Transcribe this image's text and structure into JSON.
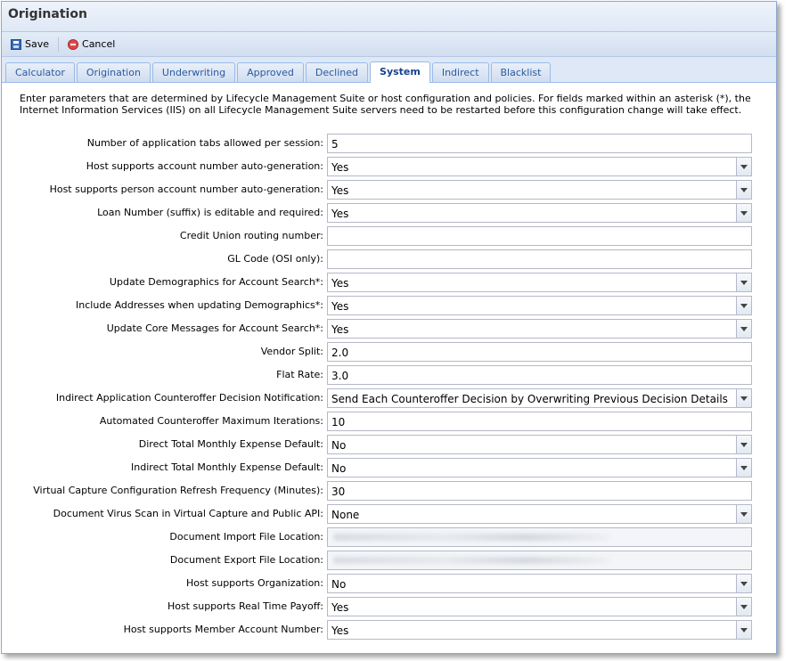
{
  "window": {
    "title": "Origination"
  },
  "toolbar": {
    "save_label": "Save",
    "cancel_label": "Cancel"
  },
  "tabs": [
    {
      "label": "Calculator"
    },
    {
      "label": "Origination"
    },
    {
      "label": "Underwriting"
    },
    {
      "label": "Approved"
    },
    {
      "label": "Declined"
    },
    {
      "label": "System",
      "active": true
    },
    {
      "label": "Indirect"
    },
    {
      "label": "Blacklist"
    }
  ],
  "intro": "Enter parameters that are determined by Lifecycle Management Suite or host configuration and policies. For fields marked within an asterisk (*), the Internet Information Services (IIS) on all Lifecycle Management Suite servers need to be restarted before this configuration change will take effect.",
  "fields": [
    {
      "label": "Number of application tabs allowed per session:",
      "value": "5",
      "type": "text"
    },
    {
      "label": "Host supports account number auto-generation:",
      "value": "Yes",
      "type": "combo"
    },
    {
      "label": "Host supports person account number auto-generation:",
      "value": "Yes",
      "type": "combo"
    },
    {
      "label": "Loan Number (suffix) is editable and required:",
      "value": "Yes",
      "type": "combo"
    },
    {
      "label": "Credit Union routing number:",
      "value": "",
      "type": "text"
    },
    {
      "label": "GL Code (OSI only):",
      "value": "",
      "type": "text"
    },
    {
      "label": "Update Demographics for Account Search*:",
      "value": "Yes",
      "type": "combo"
    },
    {
      "label": "Include Addresses when updating Demographics*:",
      "value": "Yes",
      "type": "combo"
    },
    {
      "label": "Update Core Messages for Account Search*:",
      "value": "Yes",
      "type": "combo"
    },
    {
      "label": "Vendor Split:",
      "value": "2.0",
      "type": "text"
    },
    {
      "label": "Flat Rate:",
      "value": "3.0",
      "type": "text"
    },
    {
      "label": "Indirect Application Counteroffer Decision Notification:",
      "value": "Send Each Counteroffer Decision by Overwriting Previous Decision Details",
      "type": "combo"
    },
    {
      "label": "Automated Counteroffer Maximum Iterations:",
      "value": "10",
      "type": "text"
    },
    {
      "label": "Direct Total Monthly Expense Default:",
      "value": "No",
      "type": "combo"
    },
    {
      "label": "Indirect Total Monthly Expense Default:",
      "value": "No",
      "type": "combo"
    },
    {
      "label": "Virtual Capture Configuration Refresh Frequency (Minutes):",
      "value": "30",
      "type": "text"
    },
    {
      "label": "Document Virus Scan in Virtual Capture and Public API:",
      "value": "None",
      "type": "combo"
    },
    {
      "label": "Document Import File Location:",
      "value": "",
      "type": "blurred"
    },
    {
      "label": "Document Export File Location:",
      "value": "",
      "type": "blurred"
    },
    {
      "label": "Host supports Organization:",
      "value": "No",
      "type": "combo"
    },
    {
      "label": "Host supports Real Time Payoff:",
      "value": "Yes",
      "type": "combo"
    },
    {
      "label": "Host supports Member Account Number:",
      "value": "Yes",
      "type": "combo"
    }
  ]
}
